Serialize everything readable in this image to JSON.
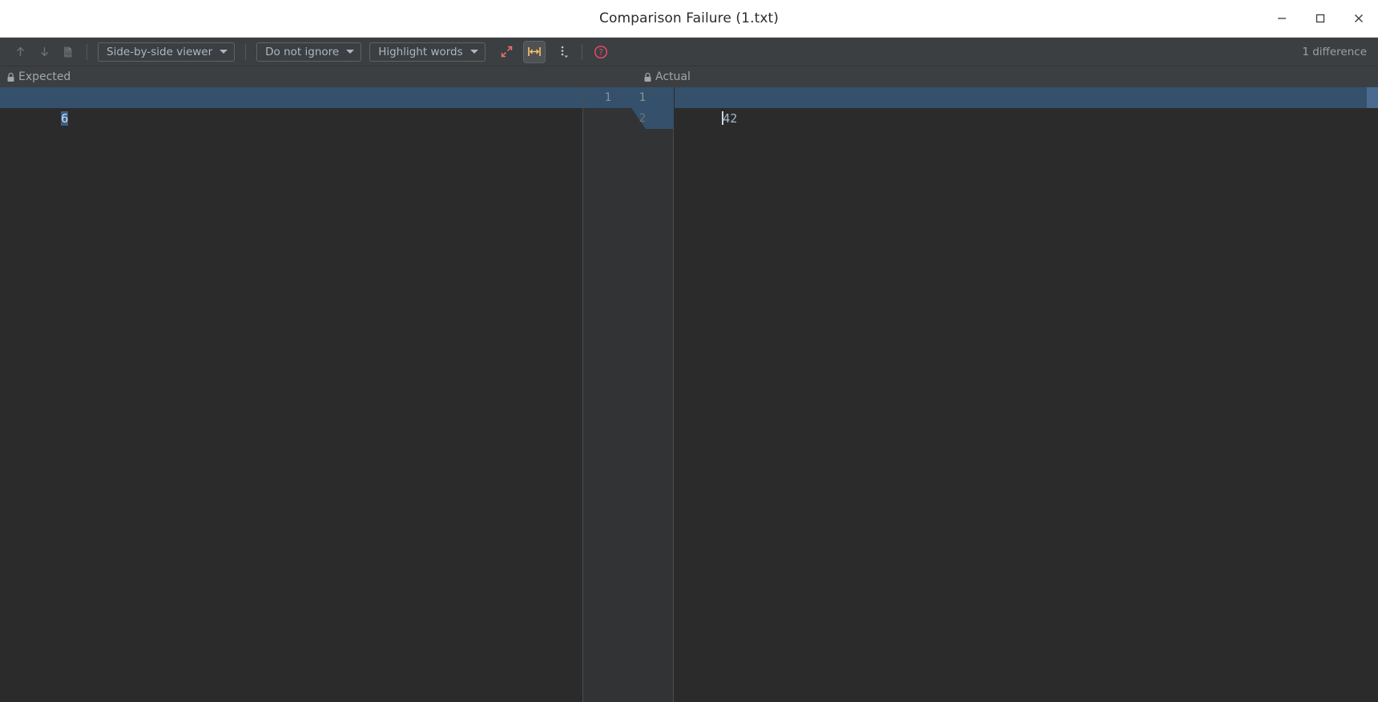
{
  "window": {
    "title": "Comparison Failure (1.txt)",
    "controls": [
      {
        "name": "minimize-button",
        "glyph": "minimize"
      },
      {
        "name": "maximize-button",
        "glyph": "maximize"
      },
      {
        "name": "close-button",
        "glyph": "close"
      }
    ]
  },
  "toolbar": {
    "previous_difference_label": "previous-difference-icon",
    "next_difference_label": "next-difference-icon",
    "compare_files_label": "compare-files-icon",
    "viewer_mode": "Side-by-side viewer",
    "ignore_mode": "Do not ignore",
    "highlight_mode": "Highlight words",
    "collapse_unchanged_label": "collapse-unchanged-fragments-icon",
    "synchronize_scroll_label": "fit-content-icon",
    "more_options_label": "more-options-icon",
    "help_label": "help-icon",
    "difference_count": "1 difference"
  },
  "panels": {
    "left": {
      "title": "Expected",
      "locked": true
    },
    "right": {
      "title": "Actual",
      "locked": true
    }
  },
  "diff": {
    "left_lines": [
      {
        "number": "1",
        "text": "6",
        "changed": true
      }
    ],
    "right_lines": [
      {
        "number": "1",
        "text": "42",
        "changed": true
      },
      {
        "number": "2",
        "text": "",
        "changed": false
      }
    ],
    "left_line_number": "1",
    "right_line_number_1": "1",
    "right_line_number_2": "2",
    "left_text": "6",
    "right_text": "42"
  },
  "colors": {
    "titlebar_bg": "#ffffff",
    "toolbar_bg": "#3c3f41",
    "editor_bg": "#2b2b2b",
    "gutter_bg": "#313335",
    "diff_highlight": "#35506b",
    "selection": "#3a5f8a",
    "accent_pink": "#f07178",
    "accent_yellow": "#ffc66d",
    "text_primary": "#a9b7c6"
  }
}
